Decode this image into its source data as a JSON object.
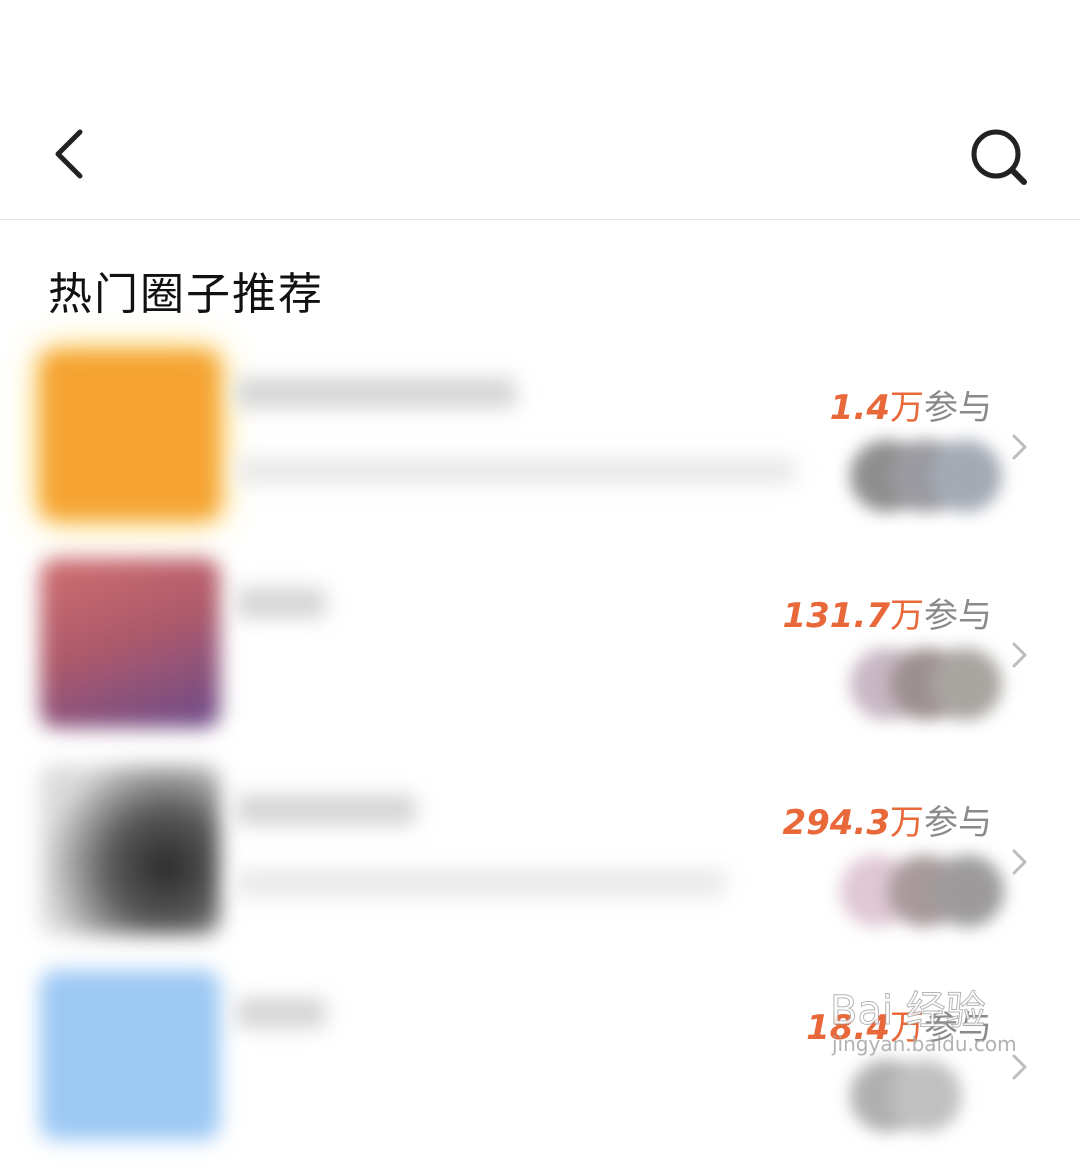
{
  "section": {
    "title": "热门圈子推荐"
  },
  "circles": [
    {
      "count": "1.4",
      "unit": "万",
      "label": "参与",
      "thumb_color": "#f5a432",
      "avatar_colors": [
        "#8f8f8f",
        "#9a9aa0",
        "#a4aab4"
      ]
    },
    {
      "count": "131.7",
      "unit": "万",
      "label": "参与",
      "thumb_color": "#b36a78",
      "avatar_colors": [
        "#c8b8c4",
        "#9d9090",
        "#a8a4a0"
      ]
    },
    {
      "count": "294.3",
      "unit": "万",
      "label": "参与",
      "thumb_color": "#5a5a5a",
      "avatar_colors": [
        "#e0c8d4",
        "#a89a9c",
        "#9c9a9a"
      ]
    },
    {
      "count": "18.4",
      "unit": "万",
      "label": "参与",
      "thumb_color": "#9cc8f4",
      "avatar_colors": [
        "#b0b0b0",
        "#c0c0c0",
        "#d0d0d0"
      ]
    }
  ],
  "watermark": {
    "brand": "Bai 经验",
    "url": "jingyan.baidu.com"
  }
}
